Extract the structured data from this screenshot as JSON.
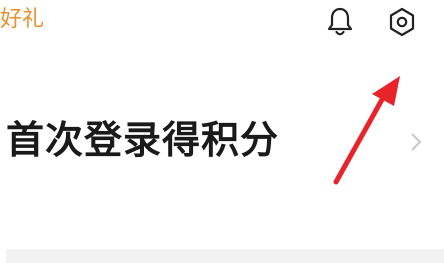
{
  "header": {
    "brand_text": "好礼",
    "brand_color": "#e8922e",
    "icons": [
      "bell-icon",
      "settings-hexagon-icon"
    ]
  },
  "login_reward": {
    "title": "首次登录得积分",
    "chevron_icon": "chevron-right-icon"
  },
  "annotation": {
    "arrow_color": "#e8232a"
  }
}
